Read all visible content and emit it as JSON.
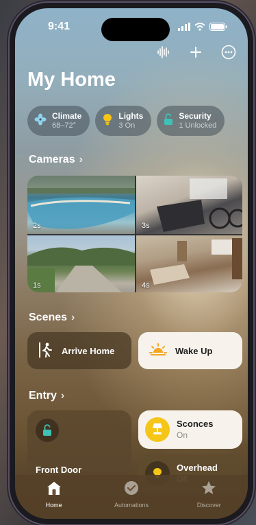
{
  "status": {
    "time": "9:41"
  },
  "header": {
    "title": "My Home"
  },
  "chips": [
    {
      "label": "Climate",
      "sub": "68–72°",
      "icon": "fan-icon"
    },
    {
      "label": "Lights",
      "sub": "3 On",
      "icon": "lightbulb-icon"
    },
    {
      "label": "Security",
      "sub": "1 Unlocked",
      "icon": "lock-icon"
    }
  ],
  "cameras": {
    "heading": "Cameras",
    "feeds": [
      {
        "age": "2s",
        "scene": "pool"
      },
      {
        "age": "3s",
        "scene": "garage"
      },
      {
        "age": "1s",
        "scene": "driveway"
      },
      {
        "age": "4s",
        "scene": "living-room"
      }
    ]
  },
  "scenes": {
    "heading": "Scenes",
    "items": [
      {
        "label": "Arrive Home",
        "icon": "walk-in-icon"
      },
      {
        "label": "Wake Up",
        "icon": "sunrise-icon"
      }
    ]
  },
  "entry": {
    "heading": "Entry",
    "front_door": {
      "label": "Front Door"
    },
    "sconces": {
      "label": "Sconces",
      "state": "On"
    },
    "overhead": {
      "label": "Overhead",
      "state": "Off"
    }
  },
  "tabs": [
    {
      "label": "Home",
      "icon": "house-icon",
      "active": true
    },
    {
      "label": "Automations",
      "icon": "clock-check-icon",
      "active": false
    },
    {
      "label": "Discover",
      "icon": "star-icon",
      "active": false
    }
  ],
  "colors": {
    "accent_yellow": "#f5c518",
    "lock_teal": "#3fc2b5"
  }
}
